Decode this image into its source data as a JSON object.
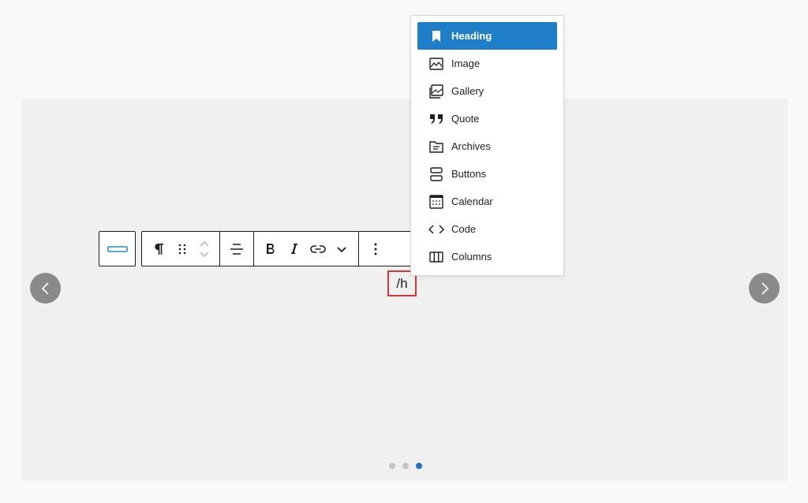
{
  "slash_query": "/h",
  "block_menu": {
    "items": [
      {
        "label": "Heading",
        "icon": "bookmark-icon",
        "selected": true
      },
      {
        "label": "Image",
        "icon": "image-icon"
      },
      {
        "label": "Gallery",
        "icon": "gallery-icon"
      },
      {
        "label": "Quote",
        "icon": "quote-icon"
      },
      {
        "label": "Archives",
        "icon": "archive-folder-icon"
      },
      {
        "label": "Buttons",
        "icon": "buttons-icon"
      },
      {
        "label": "Calendar",
        "icon": "calendar-icon"
      },
      {
        "label": "Code",
        "icon": "code-icon"
      },
      {
        "label": "Columns",
        "icon": "columns-icon"
      }
    ]
  },
  "carousel": {
    "slide_count": 3,
    "active_slide": 3
  },
  "colors": {
    "accent": "#1e7ec8",
    "highlight_border": "#d63638",
    "dot_active": "#1e74c9"
  }
}
